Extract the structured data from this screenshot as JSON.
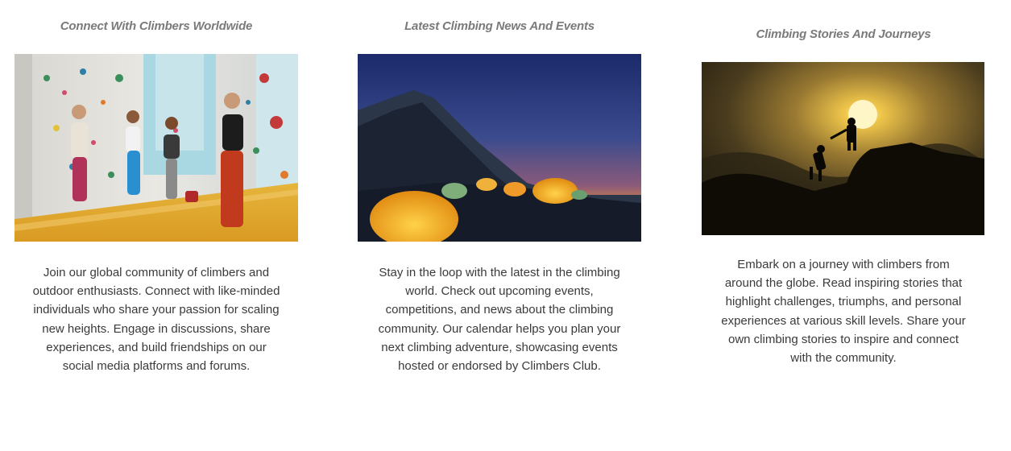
{
  "cards": [
    {
      "title": "Connect With Climbers Worldwide",
      "image": "indoor-climbing-gym-photo",
      "text": "Join our global community of climbers and outdoor enthusiasts. Connect with like-minded individuals who share your passion for scaling new heights. Engage in discussions, share experiences, and build friendships on our social media platforms and forums."
    },
    {
      "title": "Latest Climbing News And Events",
      "image": "mountain-camp-tents-night-photo",
      "text": "Stay in the loop with the latest in the climbing world. Check out upcoming events, competitions, and news about the climbing community. Our calendar helps you plan your next climbing adventure, showcasing events hosted or endorsed by Climbers Club."
    },
    {
      "title": "Climbing Stories And Journeys",
      "image": "climbers-helping-hand-sunset-photo",
      "text": "Embark on a journey with climbers from around the globe. Read inspiring stories that highlight challenges, triumphs, and personal experiences at various skill levels. Share your own climbing stories to inspire and connect with the community."
    }
  ]
}
